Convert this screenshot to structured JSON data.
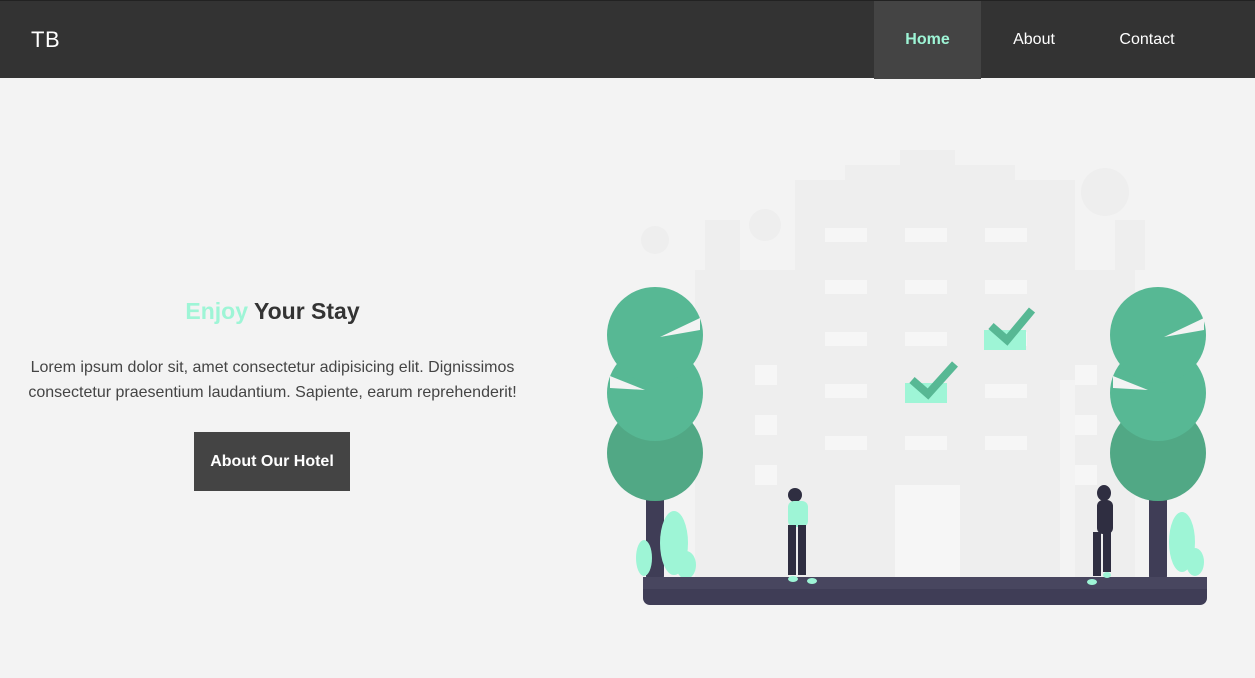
{
  "brand": {
    "logo": "TB"
  },
  "nav": {
    "items": [
      {
        "label": "Home"
      },
      {
        "label": "About"
      },
      {
        "label": "Contact"
      }
    ]
  },
  "hero": {
    "title_accent": "Enjoy",
    "title_rest": "Your Stay",
    "description": "Lorem ipsum dolor sit, amet consectetur adipisicing elit. Dignissimos consectetur praesentium laudantium. Sapiente, earum reprehenderit!",
    "button_label": "About Our Hotel"
  },
  "colors": {
    "navbar": "#333333",
    "nav_active_bg": "#444444",
    "accent": "#9ef5d6",
    "tree": "#57b894",
    "ground": "#3f3d56"
  },
  "icons": [
    "tree-icon",
    "checkmark-icon",
    "person-icon",
    "building-icon",
    "leaf-icon"
  ]
}
